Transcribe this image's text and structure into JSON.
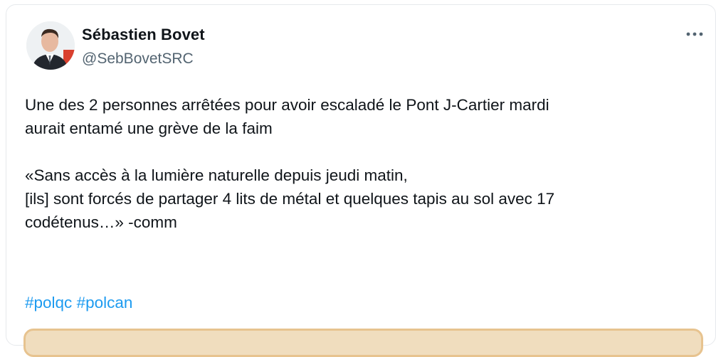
{
  "author": {
    "name": "Sébastien Bovet",
    "handle": "@SebBovetSRC"
  },
  "tweet": {
    "lines": [
      "Une des 2 personnes arrêtées pour avoir escaladé le Pont J-Cartier mardi",
      "aurait entamé une grève de la faim",
      "«Sans accès à la lumière naturelle depuis jeudi matin,",
      "[ils] sont forcés de partager 4 lits de métal et quelques tapis au sol avec 17",
      "codétenus…» -comm"
    ],
    "hashtags": [
      "#polqc",
      "#polcan"
    ]
  },
  "icons": {
    "avatar": "profile-photo",
    "more": "more-options-icon"
  },
  "colors": {
    "text": "#0f1419",
    "secondary": "#536471",
    "link": "#1d9bf0",
    "border": "#e6e9ec",
    "preview_border": "#e7c38f"
  }
}
